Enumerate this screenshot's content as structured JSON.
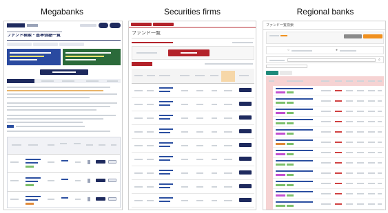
{
  "labels": {
    "megabanks": "Megabanks",
    "securities": "Securities firms",
    "regional": "Regional banks"
  },
  "screens": {
    "megabank": {
      "title": "ファンド検索・基準価額一覧"
    },
    "securities": {
      "title": "ファンド一覧"
    },
    "regional": {
      "title": "ファンド一覧検索"
    }
  },
  "colors": {
    "mega_navy": "#1e2a5e",
    "sec_red": "#b3222a",
    "reg_orange": "#f0901e",
    "reg_pink": "#f6d3d3",
    "link_blue": "#2a4ea0"
  }
}
